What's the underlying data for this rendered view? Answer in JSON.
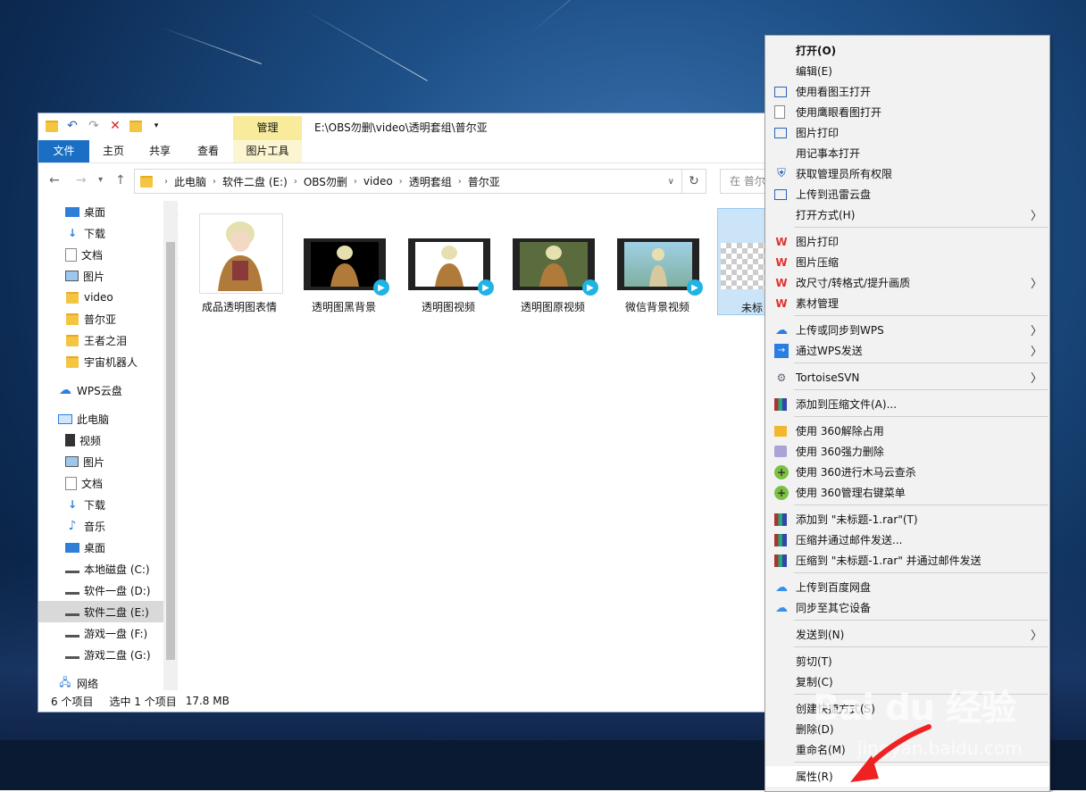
{
  "explorer": {
    "title_path": "E:\\OBS勿删\\video\\透明套组\\普尔亚",
    "context_tab": "管理",
    "ribbon_tabs": [
      "文件",
      "主页",
      "共享",
      "查看"
    ],
    "context_subtab": "图片工具",
    "breadcrumbs": [
      "此电脑",
      "软件二盘 (E:)",
      "OBS勿删",
      "video",
      "透明套组",
      "普尔亚"
    ],
    "search_placeholder": "在 普尔",
    "nav": [
      {
        "label": "桌面",
        "icon": "desktop-icon",
        "pinned": true
      },
      {
        "label": "下载",
        "icon": "download-icon",
        "pinned": true
      },
      {
        "label": "文档",
        "icon": "document-icon",
        "pinned": true
      },
      {
        "label": "图片",
        "icon": "picture-icon",
        "pinned": true
      },
      {
        "label": "video",
        "icon": "folder-icon"
      },
      {
        "label": "普尔亚",
        "icon": "folder-icon"
      },
      {
        "label": "王者之泪",
        "icon": "folder-icon"
      },
      {
        "label": "宇宙机器人",
        "icon": "folder-icon"
      },
      {
        "label": "WPS云盘",
        "icon": "cloud-icon"
      },
      {
        "label": "此电脑",
        "icon": "computer-icon"
      },
      {
        "label": "视频",
        "icon": "video-icon"
      },
      {
        "label": "图片",
        "icon": "picture-icon"
      },
      {
        "label": "文档",
        "icon": "document-icon"
      },
      {
        "label": "下载",
        "icon": "download-icon"
      },
      {
        "label": "音乐",
        "icon": "music-icon"
      },
      {
        "label": "桌面",
        "icon": "desktop-icon"
      },
      {
        "label": "本地磁盘 (C:)",
        "icon": "drive-icon"
      },
      {
        "label": "软件一盘 (D:)",
        "icon": "drive-icon"
      },
      {
        "label": "软件二盘 (E:)",
        "icon": "drive-icon",
        "selected": true
      },
      {
        "label": "游戏一盘 (F:)",
        "icon": "drive-icon"
      },
      {
        "label": "游戏二盘 (G:)",
        "icon": "drive-icon"
      },
      {
        "label": "网络",
        "icon": "network-icon"
      }
    ],
    "files": [
      {
        "name": "成品透明图表情",
        "kind": "image"
      },
      {
        "name": "透明图黑背景",
        "kind": "video"
      },
      {
        "name": "透明图视频",
        "kind": "video"
      },
      {
        "name": "透明图原视频",
        "kind": "video"
      },
      {
        "name": "微信背景视频",
        "kind": "video"
      },
      {
        "name": "未标",
        "kind": "transparent-image",
        "selected": true
      }
    ],
    "status": {
      "count": "6 个项目",
      "selection": "选中 1 个项目",
      "size": "17.8 MB"
    }
  },
  "context_menu": {
    "items": [
      "打开(O)",
      "编辑(E)",
      "使用看图王打开",
      "使用鹰眼看图打开",
      "图片打印",
      "用记事本打开",
      "获取管理员所有权限",
      "上传到迅雷云盘",
      "打开方式(H)",
      "图片打印",
      "图片压缩",
      "改尺寸/转格式/提升画质",
      "素材管理",
      "上传或同步到WPS",
      "通过WPS发送",
      "TortoiseSVN",
      "添加到压缩文件(A)...",
      "使用 360解除占用",
      "使用 360强力删除",
      "使用 360进行木马云查杀",
      "使用 360管理右键菜单",
      "添加到 \"未标题-1.rar\"(T)",
      "压缩并通过邮件发送...",
      "压缩到 \"未标题-1.rar\" 并通过邮件发送",
      "上传到百度网盘",
      "同步至其它设备",
      "发送到(N)",
      "剪切(T)",
      "复制(C)",
      "创建快捷方式(S)",
      "删除(D)",
      "重命名(M)",
      "属性(R)"
    ]
  },
  "watermark": {
    "main": "Bai du 经验",
    "sub": "jingyan.baidu.com"
  }
}
